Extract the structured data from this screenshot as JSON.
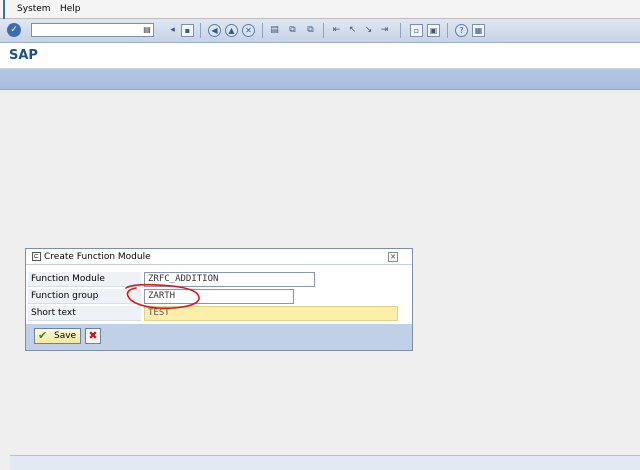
{
  "menu": {
    "system": "System",
    "help": "Help"
  },
  "toolbar": {
    "command_value": "",
    "icons": [
      "enter-icon",
      "command-field-dropdown-icon",
      "back-icon",
      "save-icon",
      "back-green-icon",
      "exit-icon",
      "cancel-icon",
      "print-icon",
      "find-icon",
      "find-next-icon",
      "first-page-icon",
      "previous-page-icon",
      "next-page-icon",
      "last-page-icon",
      "new-session-icon",
      "shortcut-icon",
      "help-icon",
      "layout-icon"
    ]
  },
  "title": "SAP",
  "dialog": {
    "title": "Create Function Module",
    "fields": [
      {
        "label": "Function Module",
        "value": "ZRFC_ADDITION"
      },
      {
        "label": "Function group",
        "value": "ZARTH"
      },
      {
        "label": "Short text",
        "value": "TEST"
      }
    ],
    "save_label": "Save"
  },
  "colors": {
    "sap_blue": "#1f4e8c",
    "dialog_footer": "#bfd0e8",
    "required_field": "#fcf0a8",
    "annotation_red": "#d41a1a"
  }
}
